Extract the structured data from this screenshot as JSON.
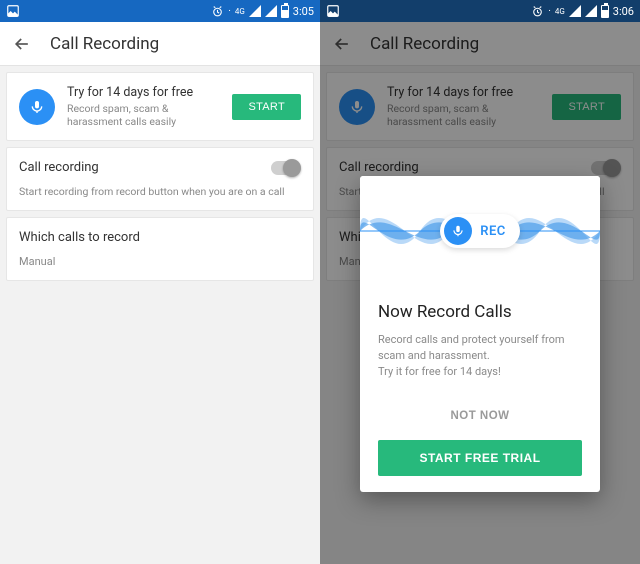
{
  "screen1": {
    "status": {
      "time": "3:05",
      "net_label": "4G"
    },
    "appbar": {
      "title": "Call Recording"
    },
    "promo": {
      "title": "Try for 14 days for free",
      "subtitle": "Record spam, scam & harassment calls easily",
      "button": "START"
    },
    "recording": {
      "label": "Call recording",
      "desc": "Start recording from record button when you are on a call",
      "enabled": false
    },
    "which": {
      "label": "Which calls to record",
      "value": "Manual"
    }
  },
  "screen2": {
    "status": {
      "time": "3:06",
      "net_label": "4G"
    },
    "appbar": {
      "title": "Call Recording"
    },
    "promo": {
      "title": "Try for 14 days for free",
      "subtitle": "Record spam, scam & harassment calls easily",
      "button": "START"
    },
    "recording": {
      "label": "Call recording",
      "desc": "Start recording from record button when you are on a call",
      "enabled": false
    },
    "which": {
      "label": "Which calls to record",
      "value": "Manual"
    },
    "modal": {
      "rec_label": "REC",
      "title": "Now Record Calls",
      "desc_line1": "Record calls and protect yourself from scam and harassment.",
      "desc_line2": "Try it for free for 14 days!",
      "not_now": "NOT NOW",
      "start_trial": "START FREE TRIAL"
    }
  },
  "colors": {
    "status_bar": "#1668c1",
    "status_bar_dim": "#123e6b",
    "accent_green": "#27b97c",
    "accent_blue": "#2b90f5"
  }
}
